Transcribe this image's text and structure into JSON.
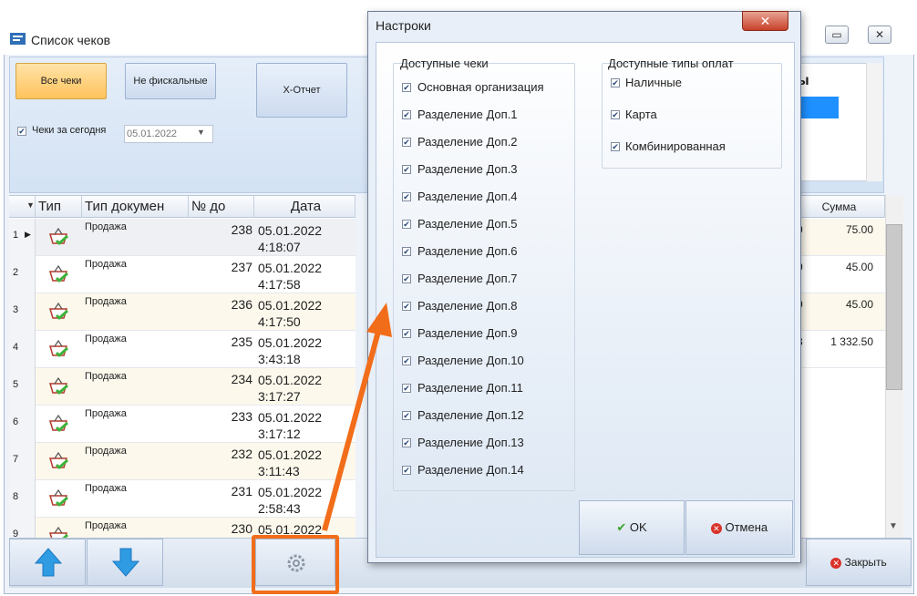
{
  "main": {
    "title": "Список чеков",
    "buttons": {
      "all_receipts": "Все чеки",
      "non_fiscal": "Не фискальные",
      "x_report": "X-Отчет",
      "close": "Закрыть"
    },
    "today_checkbox": {
      "label": "Чеки за сегодня",
      "checked": true
    },
    "date_value": "05.01.2022",
    "partial_header": "ы",
    "columns": [
      "Тип",
      "Тип докумен",
      "№ до",
      "Дата"
    ],
    "sum_header": "Сумма",
    "rows": [
      {
        "n": "1",
        "doc": "Продажа",
        "num": "238",
        "date": "05.01.2022",
        "time": "4:18:07"
      },
      {
        "n": "2",
        "doc": "Продажа",
        "num": "237",
        "date": "05.01.2022",
        "time": "4:17:58"
      },
      {
        "n": "3",
        "doc": "Продажа",
        "num": "236",
        "date": "05.01.2022",
        "time": "4:17:50"
      },
      {
        "n": "4",
        "doc": "Продажа",
        "num": "235",
        "date": "05.01.2022",
        "time": "3:43:18"
      },
      {
        "n": "5",
        "doc": "Продажа",
        "num": "234",
        "date": "05.01.2022",
        "time": "3:17:27"
      },
      {
        "n": "6",
        "doc": "Продажа",
        "num": "233",
        "date": "05.01.2022",
        "time": "3:17:12"
      },
      {
        "n": "7",
        "doc": "Продажа",
        "num": "232",
        "date": "05.01.2022",
        "time": "3:11:43"
      },
      {
        "n": "8",
        "doc": "Продажа",
        "num": "231",
        "date": "05.01.2022",
        "time": "2:58:43"
      },
      {
        "n": "9",
        "doc": "Продажа",
        "num": "230",
        "date": "05.01.2022",
        "time": ""
      }
    ],
    "sums": [
      {
        "partial": "0",
        "value": "75.00"
      },
      {
        "partial": "0",
        "value": "45.00"
      },
      {
        "partial": "0",
        "value": "45.00"
      },
      {
        "partial": "3",
        "value": "1 332.50"
      }
    ]
  },
  "dialog": {
    "title": "Настроки",
    "receipts_group": {
      "title": "Доступные чеки",
      "items": [
        "Основная организация",
        "Разделение Доп.1",
        "Разделение Доп.2",
        "Разделение Доп.3",
        "Разделение Доп.4",
        "Разделение Доп.5",
        "Разделение Доп.6",
        "Разделение Доп.7",
        "Разделение Доп.8",
        "Разделение Доп.9",
        "Разделение Доп.10",
        "Разделение Доп.11",
        "Разделение Доп.12",
        "Разделение Доп.13",
        "Разделение Доп.14"
      ]
    },
    "payments_group": {
      "title": "Доступные типы оплат",
      "items": [
        "Наличные",
        "Карта",
        "Комбинированная"
      ]
    },
    "ok": "OK",
    "cancel": "Отмена"
  },
  "colors": {
    "annotation": "#f26d1a",
    "accent": "#ffc35c",
    "selection": "#1e90ff"
  }
}
